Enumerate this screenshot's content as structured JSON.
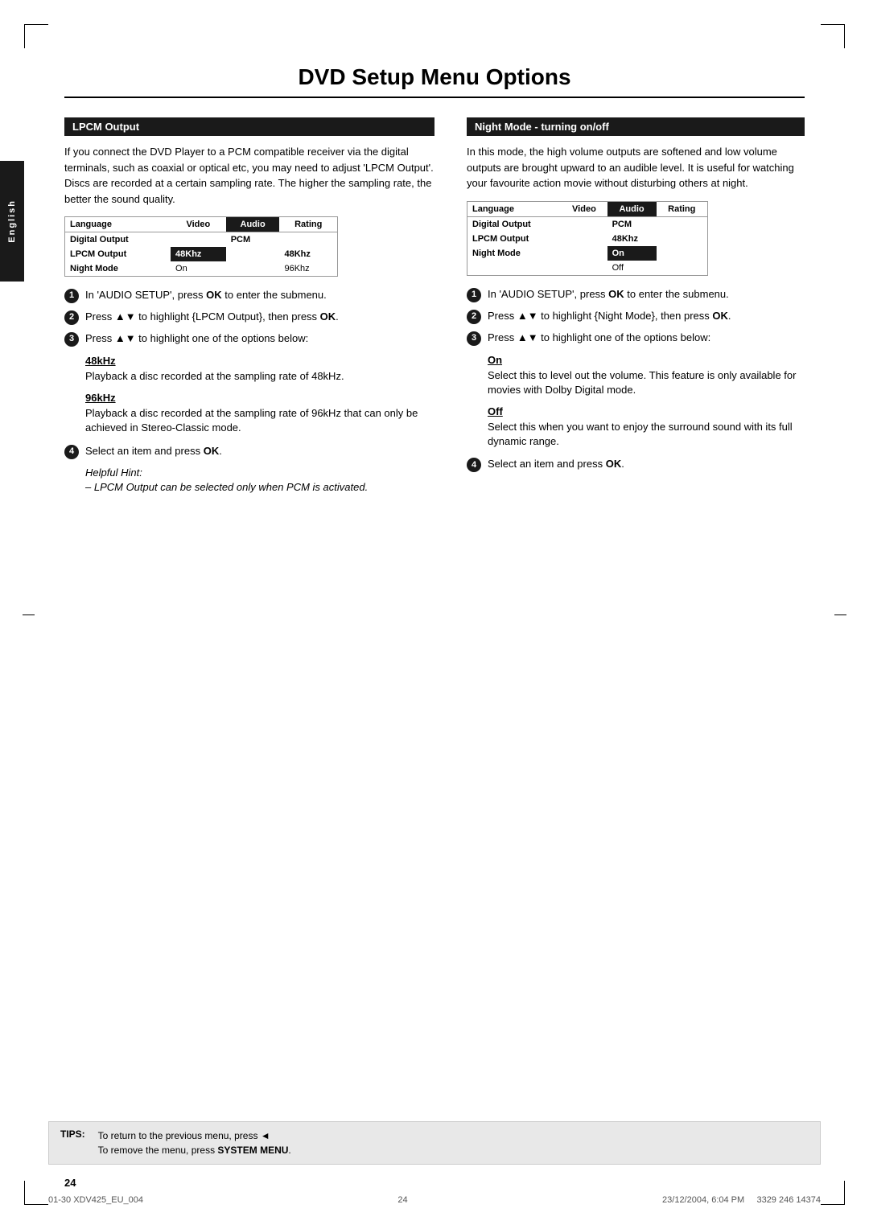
{
  "page": {
    "title": "DVD Setup Menu Options",
    "page_number": "24",
    "sidebar_label": "English"
  },
  "lpcm_section": {
    "header": "LPCM Output",
    "intro_text": "If you connect the DVD Player to a PCM compatible receiver via the digital terminals, such as coaxial or optical etc, you may need to adjust 'LPCM Output'. Discs are recorded at a certain sampling rate. The higher the sampling rate, the better the sound quality.",
    "table": {
      "headers": [
        "Language",
        "Video",
        "Audio",
        "Rating"
      ],
      "rows": [
        [
          "Digital Output",
          "",
          "PCM",
          ""
        ],
        [
          "LPCM Output",
          "48Khz",
          "",
          "48Khz"
        ],
        [
          "Night Mode",
          "",
          "On",
          "96Khz"
        ]
      ],
      "highlight_header_col": "Audio",
      "highlight_row_index": 1,
      "highlight_row_col_index": 1
    },
    "steps": [
      {
        "num": "1",
        "text": "In 'AUDIO SETUP', press OK to enter the submenu."
      },
      {
        "num": "2",
        "text": "Press ▲▼ to highlight {LPCM Output}, then press OK."
      },
      {
        "num": "3",
        "text": "Press ▲▼ to highlight one of the options below:"
      }
    ],
    "options": [
      {
        "title": "48kHz",
        "text": "Playback a disc recorded at the sampling rate of 48kHz."
      },
      {
        "title": "96kHz",
        "text": "Playback a disc recorded at the sampling rate of 96kHz that can only be achieved in Stereo-Classic mode."
      }
    ],
    "step4": "Select an item and press OK.",
    "helpful_hint_title": "Helpful Hint:",
    "helpful_hint_text": "– LPCM Output can be selected only when PCM is activated."
  },
  "night_mode_section": {
    "header": "Night Mode - turning on/off",
    "intro_text": "In this mode, the high volume outputs are softened and low volume outputs are brought upward to an audible level. It is useful for watching your favourite action movie without disturbing others at night.",
    "table": {
      "headers": [
        "Language",
        "Video",
        "Audio",
        "Rating"
      ],
      "rows": [
        [
          "Digital Output",
          "",
          "PCM",
          ""
        ],
        [
          "LPCM Output",
          "",
          "48Khz",
          ""
        ],
        [
          "Night Mode",
          "",
          "On",
          ""
        ]
      ],
      "highlight_header_col": "Audio",
      "on_value": "On",
      "off_value": "Off"
    },
    "steps": [
      {
        "num": "1",
        "text": "In 'AUDIO SETUP', press OK to enter the submenu."
      },
      {
        "num": "2",
        "text": "Press ▲▼ to highlight {Night Mode}, then press OK."
      },
      {
        "num": "3",
        "text": "Press ▲▼ to highlight one of the options below:"
      }
    ],
    "options": [
      {
        "title": "On",
        "text": "Select this to level out the volume. This feature is only available for movies with Dolby Digital mode."
      },
      {
        "title": "Off",
        "text": "Select this when you want to enjoy the surround sound with its full dynamic range."
      }
    ],
    "step4": "Select an item and press OK."
  },
  "tips": {
    "label": "TIPS:",
    "line1": "To return to the previous menu, press ◄",
    "line2": "To remove the menu, press SYSTEM MENU"
  },
  "footer": {
    "doc_ref": "01-30 XDV425_EU_004",
    "page_mid": "24",
    "date_ref": "23/12/2004, 6:04 PM",
    "phone": "3329 246 14374"
  }
}
